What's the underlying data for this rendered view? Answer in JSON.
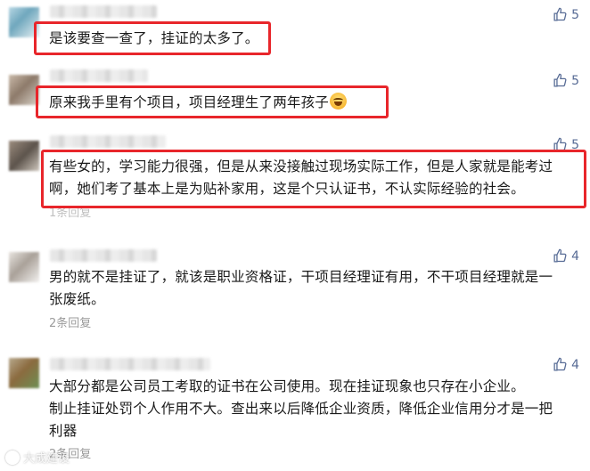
{
  "colors": {
    "highlight": "#e8262b",
    "like": "#576b95",
    "meta": "#9b9b9b"
  },
  "comments": [
    {
      "likes": "5",
      "text": "是该要查一查了，挂证的太多了。",
      "replies": ""
    },
    {
      "likes": "5",
      "text": "原来我手里有个项目，项目经理生了两年孩子",
      "emoji": "laughing-emoji",
      "replies": ""
    },
    {
      "likes": "5",
      "text_lines": [
        "有些女的，学习能力很强，但是从来没接触过现场实际工作，但是人家就是能考过",
        "啊，她们考了基本上是为贴补家用，这是个只认证书，不认实际经验的社会。"
      ],
      "replies": "1条回复"
    },
    {
      "likes": "4",
      "text_lines": [
        "男的就不是挂证了，就该是职业资格证，干项目经理证有用，不干项目经理就是一",
        "张废纸。"
      ],
      "replies": "2条回复"
    },
    {
      "likes": "4",
      "text_lines": [
        "大部分都是公司员工考取的证书在公司使用。现在挂证现象也只存在小企业。",
        "制止挂证处罚个人作用不大。查出来以后降低企业资质，降低企业信用分才是一把",
        "利器"
      ],
      "replies": "2条回复"
    }
  ],
  "watermark": "大成建设"
}
